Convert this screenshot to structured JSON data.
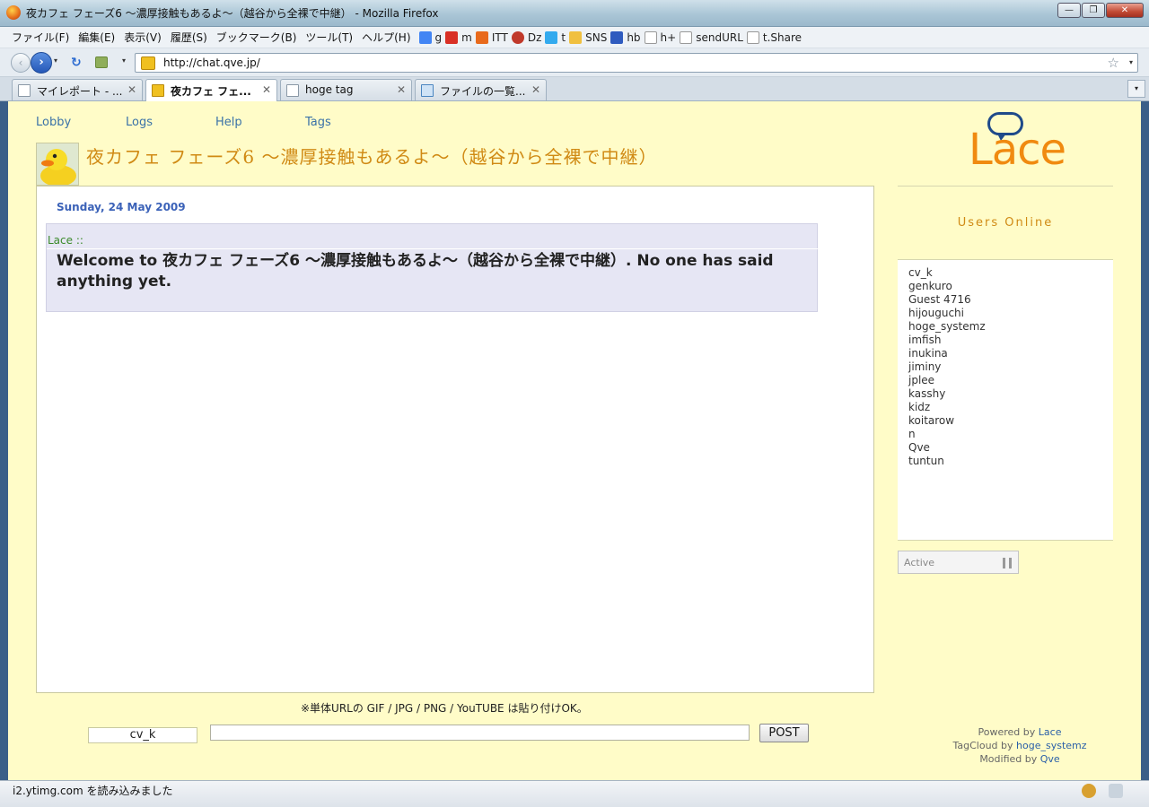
{
  "window": {
    "title": "夜カフェ フェーズ6 〜濃厚接触もあるよ〜（越谷から全裸で中継） - Mozilla Firefox",
    "minimize": "—",
    "maximize": "❐",
    "close": "✕"
  },
  "menu": [
    "ファイル(F)",
    "編集(E)",
    "表示(V)",
    "履歴(S)",
    "ブックマーク(B)",
    "ツール(T)",
    "ヘルプ(H)"
  ],
  "bookmarks": [
    {
      "label": "g",
      "color": "#4285f4"
    },
    {
      "label": "m",
      "color": "#d93025"
    },
    {
      "label": "ITT",
      "color": "#e86a1c"
    },
    {
      "label": "Dz",
      "color": "#c0392b"
    },
    {
      "label": "t",
      "color": "#33aaee"
    },
    {
      "label": "SNS",
      "color": "#f0c040"
    },
    {
      "label": "hb",
      "color": "#2f5bbf"
    },
    {
      "label": "h+",
      "color": "#ffffff"
    },
    {
      "label": "sendURL",
      "color": "#ffffff"
    },
    {
      "label": "t.Share",
      "color": "#ffffff"
    }
  ],
  "nav": {
    "url": "http://chat.qve.jp/",
    "back": "‹",
    "forward": "›",
    "reload": "↻",
    "star": "☆",
    "dropdown": "▾"
  },
  "tabs": [
    {
      "label": "マイレポート - ...",
      "close": "✕"
    },
    {
      "label": "夜カフェ フェ...",
      "close": "✕"
    },
    {
      "label": "hoge tag",
      "close": "✕"
    },
    {
      "label": "ファイルの一覧...",
      "close": "✕"
    }
  ],
  "tablist_icon": "▾",
  "site": {
    "links": [
      "Lobby",
      "Logs",
      "Help",
      "Tags"
    ],
    "room_title": "夜カフェ フェーズ6 〜濃厚接触もあるよ〜（越谷から全裸で中継）",
    "date": "Sunday, 24 May 2009",
    "message_author": "Lace ::",
    "message_body": "Welcome to 夜カフェ フェーズ6 〜濃厚接触もあるよ〜（越谷から全裸で中継）. No one has said anything yet.",
    "hint": "※単体URLの GIF / JPG / PNG / YouTUBE は貼り付けOK。",
    "nickname": "cv_k",
    "message_input": "",
    "post_label": "POST",
    "logo_word": "Lace",
    "users_heading": "Users Online",
    "users": [
      "cv_k",
      "genkuro",
      "Guest 4716",
      "hijouguchi",
      "hoge_systemz",
      "imfish",
      "inukina",
      "jiminy",
      "jplee",
      "kasshy",
      "kidz",
      "koitarow",
      "n",
      "Qve",
      "tuntun"
    ],
    "status_label": "Active",
    "credits": [
      {
        "prefix": "Powered by",
        "name": "Lace"
      },
      {
        "prefix": "TagCloud by",
        "name": "hoge_systemz"
      },
      {
        "prefix": "Modified by",
        "name": "Qve"
      }
    ]
  },
  "statusbar": {
    "text": "i2.ytimg.com を読み込みました"
  },
  "colors": {
    "page_bg": "#fffcc8",
    "accent_orange": "#d08a14",
    "link_blue": "#3a72a8",
    "message_bg": "#e6e6f4"
  }
}
